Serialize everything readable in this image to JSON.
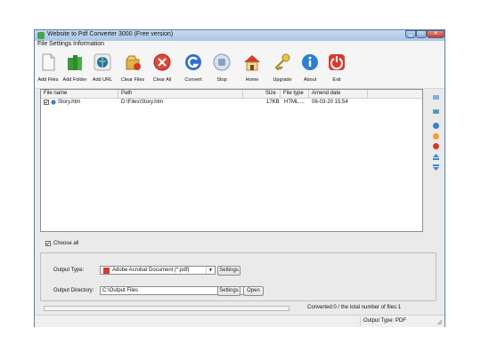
{
  "window": {
    "title": "Website to Pdf Converter 3000 (Free version)"
  },
  "menu": [
    "File",
    "Settings",
    "Information"
  ],
  "toolbar": [
    {
      "label": "Add Files",
      "icon": "document-icon"
    },
    {
      "label": "Add Folder",
      "icon": "folder-icon"
    },
    {
      "label": "Add URL",
      "icon": "globe-icon"
    },
    {
      "label": "Clear Files",
      "icon": "clear-files-icon"
    },
    {
      "label": "Clear All",
      "icon": "clear-all-icon"
    },
    {
      "label": "Convert",
      "icon": "convert-icon"
    },
    {
      "label": "Stop",
      "icon": "stop-icon"
    },
    {
      "label": "Home",
      "icon": "home-icon"
    },
    {
      "label": "Upgrade",
      "icon": "key-icon"
    },
    {
      "label": "About",
      "icon": "info-icon"
    },
    {
      "label": "Exit",
      "icon": "power-icon"
    }
  ],
  "file_list": {
    "columns": [
      "File name",
      "Path",
      "Size",
      "File type",
      "Amend date"
    ],
    "rows": [
      {
        "name": "Story.htm",
        "path": "D:\\Files\\Story.htm",
        "size": "17KB",
        "type": "HTML ...",
        "date": "08-03-20 15:54",
        "checked": true
      }
    ]
  },
  "choose_all_label": "Choose all",
  "output": {
    "type_label": "Output Type:",
    "type_value": "Adobe Acrobat Document (*.pdf)",
    "settings_label": "Settings",
    "dir_label": "Output Directory:",
    "dir_value": "C:\\Output Files",
    "open_label": "Open"
  },
  "status": {
    "converted": "Converted:0  /  the total number of files:1",
    "output_type": "Output Type: PDF"
  },
  "colors": {
    "accent": "#4a7fb7",
    "titlebar": "#a9c5e6",
    "close": "#c8392b"
  }
}
